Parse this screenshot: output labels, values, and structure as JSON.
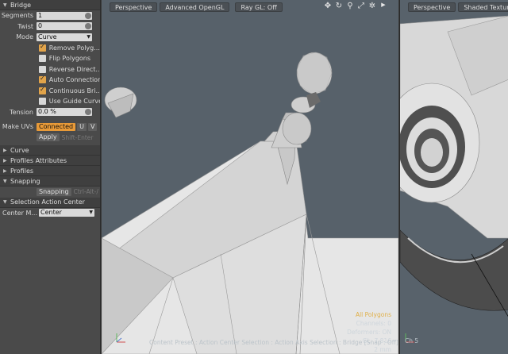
{
  "panel": {
    "title": "Bridge",
    "segments": {
      "label": "Segments",
      "value": "1"
    },
    "twist": {
      "label": "Twist",
      "value": "0"
    },
    "mode": {
      "label": "Mode",
      "value": "Curve"
    },
    "checkboxes": [
      {
        "label": "Remove Polyg...",
        "checked": true
      },
      {
        "label": "Flip Polygons",
        "checked": false
      },
      {
        "label": "Reverse Direct...",
        "checked": false
      },
      {
        "label": "Auto Connection",
        "checked": true
      },
      {
        "label": "Continuous Bri...",
        "checked": true
      },
      {
        "label": "Use Guide Curve",
        "checked": false
      }
    ],
    "tension": {
      "label": "Tension",
      "value": "0.0 %"
    },
    "make_uvs": {
      "label": "Make UVs",
      "connected": "Connected",
      "u": "U",
      "v": "V"
    },
    "apply": {
      "label": "Apply",
      "hint": "Shift-Enter"
    },
    "sections": [
      "Curve",
      "Profiles Attributes",
      "Profiles"
    ],
    "snapping": {
      "title": "Snapping",
      "button": "Snapping",
      "hint": "Ctrl-Alt-/"
    },
    "sac": {
      "title": "Selection Action Center",
      "label": "Center M...",
      "value": "Center"
    }
  },
  "viewport1": {
    "tabs": [
      "Perspective",
      "Advanced OpenGL",
      "Ray GL: Off"
    ],
    "icons": [
      "move-icon",
      "rotate-icon",
      "zoom-icon",
      "fit-icon",
      "settings-icon",
      "arrow-right-icon"
    ],
    "status": {
      "selection": "All Polygons",
      "channels": "Channels: 0",
      "deformers": "Deformers: ON",
      "gl": "GL: 7,816",
      "units": "2 mm"
    },
    "bottom_text": "Content Preset : Action Center Selection : Action Axis Selection : Bridge  [Snap : Off]"
  },
  "viewport2": {
    "tabs": [
      "Perspective",
      "Shaded Texture"
    ],
    "corner_text": "Ch 5"
  },
  "colors": {
    "accent": "#e89a38",
    "panel": "#4a4a4a",
    "viewport": "#57616a"
  }
}
